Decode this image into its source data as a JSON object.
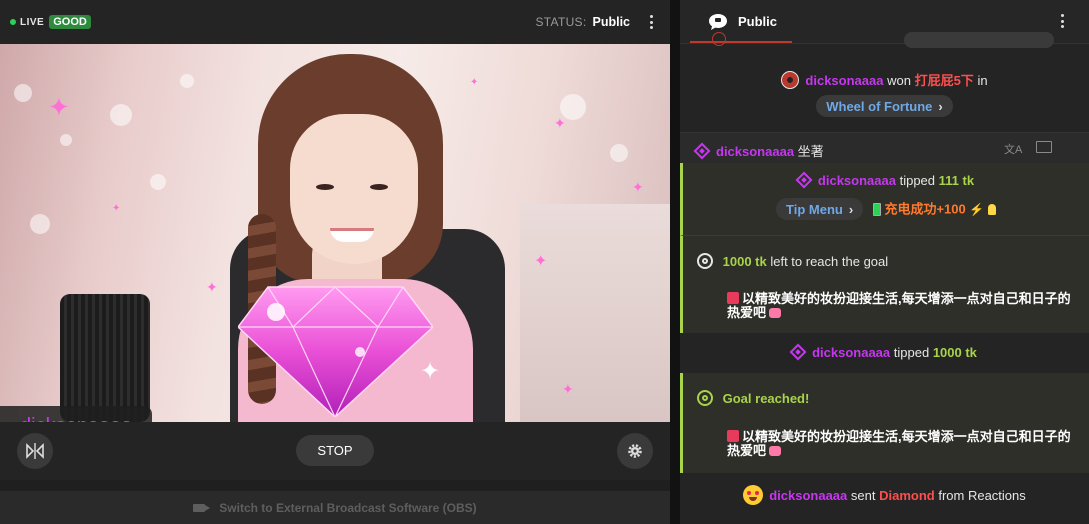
{
  "topbar": {
    "live_label": "LIVE",
    "quality_badge": "GOOD",
    "status_label": "STATUS:",
    "status_value": "Public"
  },
  "stream": {
    "streamer_name": "dicksonaaaa"
  },
  "controls": {
    "stop_label": "STOP"
  },
  "obs_bar": {
    "label": "Switch to External Broadcast Software (OBS)"
  },
  "chat": {
    "tab_label": "Public",
    "messages": {
      "wheel": {
        "user": "dicksonaaaa",
        "verb": "won",
        "prize": "打屁屁5下",
        "suffix": "in",
        "link": "Wheel of Fortune"
      },
      "plain": {
        "user": "dicksonaaaa",
        "text": "坐著"
      },
      "tip1": {
        "user": "dicksonaaaa",
        "verb": "tipped",
        "amount": "111 tk",
        "menu_link": "Tip Menu",
        "menu_item": "充电成功+100"
      },
      "goal_left": {
        "amount": "1000 tk",
        "text": "left to reach the goal",
        "goal_desc": "以精致美好的妆扮迎接生活,每天增添一点对自己和日子的热爱吧"
      },
      "tip2": {
        "user": "dicksonaaaa",
        "verb": "tipped",
        "amount": "1000 tk"
      },
      "goal_reached": {
        "title": "Goal reached!",
        "goal_desc": "以精致美好的妆扮迎接生活,每天增添一点对自己和日子的热爱吧"
      },
      "reaction": {
        "user": "dicksonaaaa",
        "verb": "sent",
        "gift": "Diamond",
        "suffix": "from Reactions"
      }
    }
  },
  "colors": {
    "live_green": "#2ed158",
    "username_purple": "#c637f0",
    "token_green": "#a8d34a",
    "accent_red": "#ff4e4e",
    "link_blue": "#6fa8e6"
  },
  "icons": {
    "chat_tab": "speech-bubble-icon",
    "mirror": "flip-horizontal-icon",
    "settings": "gear-icon",
    "goal": "target-check-icon",
    "tip": "diamond-gem-icon",
    "translate": "translate-icon",
    "report": "flag-icon",
    "camera": "video-camera-icon"
  }
}
